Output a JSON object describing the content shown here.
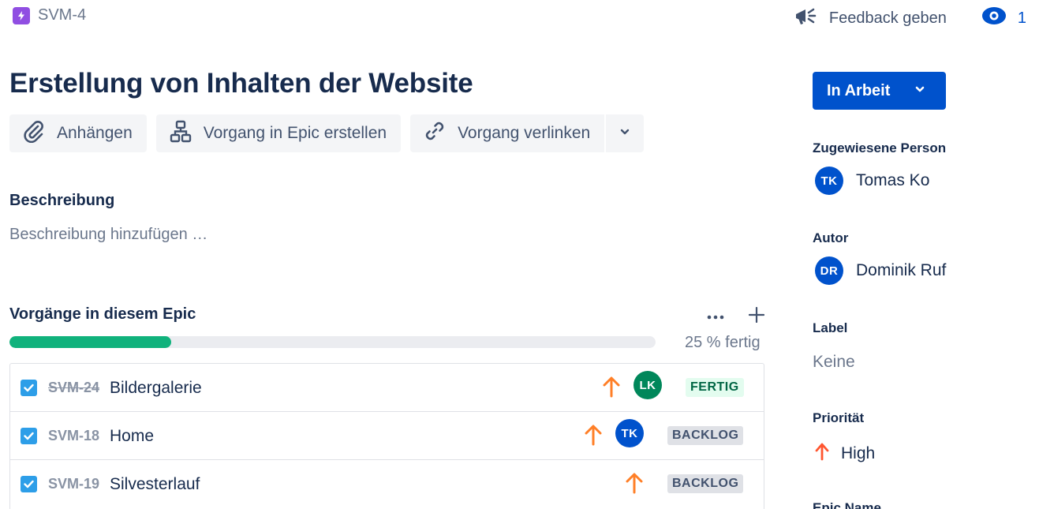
{
  "breadcrumb": {
    "issue_key": "SVM-4"
  },
  "header": {
    "feedback_label": "Feedback geben",
    "watchers_count": "1"
  },
  "issue": {
    "title": "Erstellung von Inhalten der Website"
  },
  "actions": {
    "attach": "Anhängen",
    "create_in_epic": "Vorgang in Epic erstellen",
    "link_issue": "Vorgang verlinken"
  },
  "description": {
    "heading": "Beschreibung",
    "placeholder": "Beschreibung hinzufügen …"
  },
  "child_issues": {
    "heading": "Vorgänge in diesem Epic",
    "progress_percent": 25,
    "progress_label": "25 % fertig",
    "items": [
      {
        "key": "SVM-24",
        "summary": "Bildergalerie",
        "done": true,
        "assignee_initials": "LK",
        "assignee_color": "#00875a",
        "status": "FERTIG"
      },
      {
        "key": "SVM-18",
        "summary": "Home",
        "done": false,
        "assignee_initials": "TK",
        "assignee_color": "#0052cc",
        "status": "BACKLOG"
      },
      {
        "key": "SVM-19",
        "summary": "Silvesterlauf",
        "done": false,
        "assignee_initials": "",
        "assignee_color": "",
        "status": "BACKLOG"
      }
    ]
  },
  "sidebar": {
    "status_label": "In Arbeit",
    "assignee_label": "Zugewiesene Person",
    "assignee_initials": "TK",
    "assignee_name": "Tomas Ko",
    "reporter_label": "Autor",
    "reporter_initials": "DR",
    "reporter_name": "Dominik Ruf",
    "labels_label": "Label",
    "labels_value": "Keine",
    "priority_label": "Priorität",
    "priority_value": "High",
    "epic_name_label": "Epic Name"
  },
  "colors": {
    "epic": "#904ee2",
    "primary": "#0052cc",
    "progress": "#10b27c",
    "priority_medium": "#ff7f27",
    "priority_high": "#ff5630"
  },
  "icons": [
    "epic-icon",
    "megaphone-icon",
    "eye-icon",
    "paperclip-icon",
    "hierarchy-icon",
    "link-icon",
    "chevron-down-icon",
    "more-icon",
    "plus-icon",
    "checkbox-icon",
    "priority-arrow-icon"
  ]
}
